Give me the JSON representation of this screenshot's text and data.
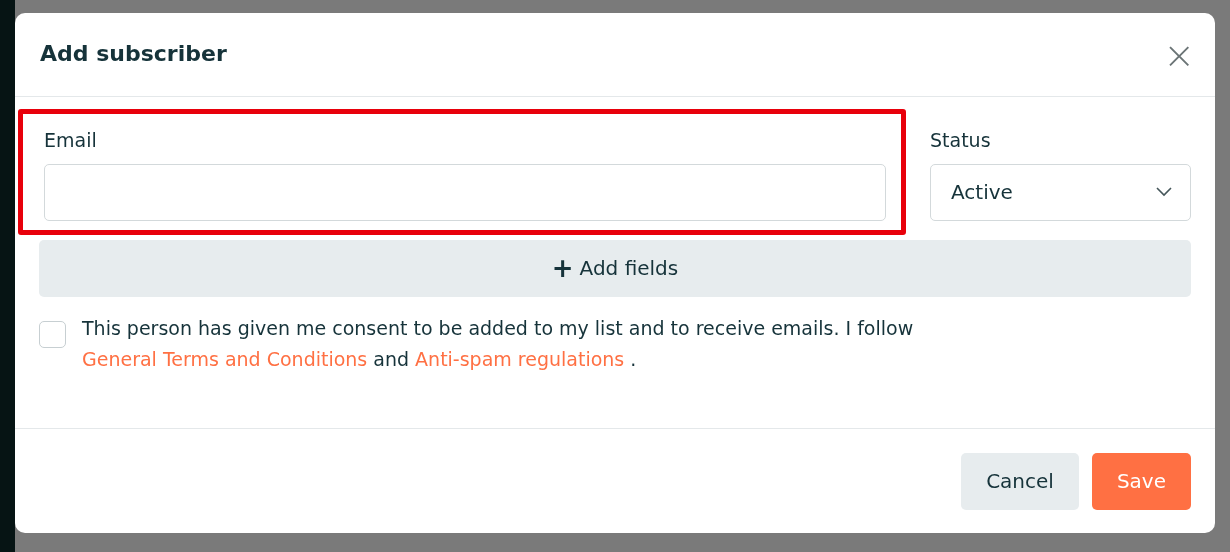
{
  "dialog": {
    "title": "Add subscriber",
    "close": "×"
  },
  "email": {
    "label": "Email",
    "highlighted": true
  },
  "status": {
    "label": "Status",
    "value": "Active"
  },
  "add_fields": {
    "icon": "+",
    "label": "Add fields"
  },
  "consent": {
    "checked": false,
    "text": "This person has given me consent to be added to my list and to receive emails. I follow ",
    "link1": "General Terms and Conditions",
    "middle": " and ",
    "link2": "Anti-spam regulations",
    "end": " ."
  },
  "buttons": [
    {
      "label": "Cancel",
      "kind": "secondary"
    },
    {
      "label": "Save",
      "kind": "primary"
    }
  ]
}
